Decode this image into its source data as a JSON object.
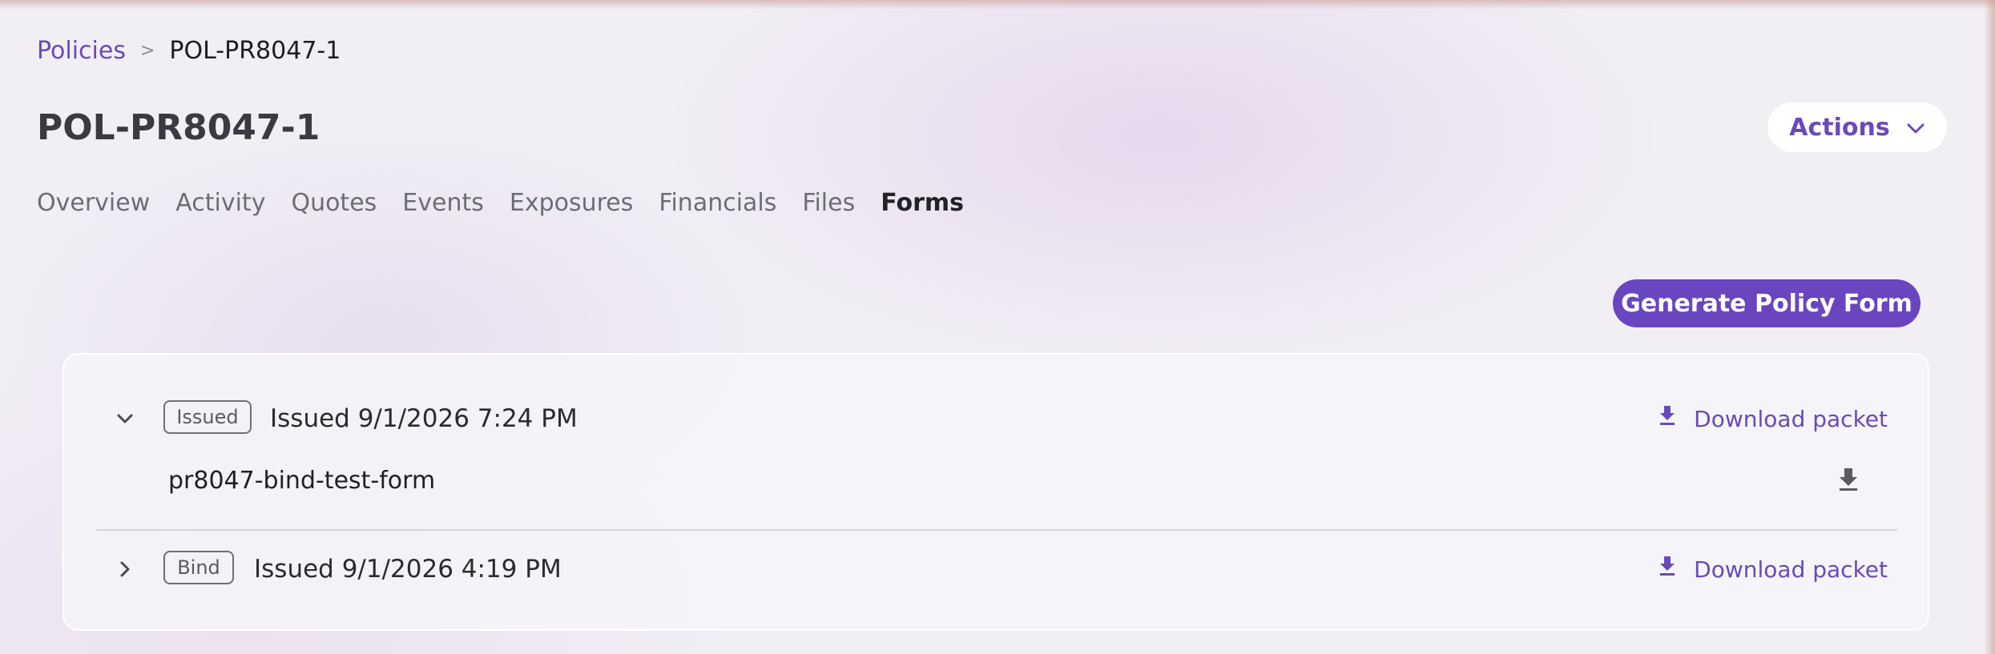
{
  "breadcrumb": {
    "parent": "Policies",
    "separator": ">",
    "current": "POL-PR8047-1"
  },
  "page": {
    "title": "POL-PR8047-1",
    "actions_label": "Actions"
  },
  "tabs": [
    {
      "label": "Overview",
      "active": false
    },
    {
      "label": "Activity",
      "active": false
    },
    {
      "label": "Quotes",
      "active": false
    },
    {
      "label": "Events",
      "active": false
    },
    {
      "label": "Exposures",
      "active": false
    },
    {
      "label": "Financials",
      "active": false
    },
    {
      "label": "Files",
      "active": false
    },
    {
      "label": "Forms",
      "active": true
    }
  ],
  "forms": {
    "generate_label": "Generate Policy Form",
    "groups": [
      {
        "badge": "Issued",
        "issued_text": "Issued 9/1/2026 7:24 PM",
        "download_label": "Download packet",
        "expanded": true,
        "files": [
          {
            "name": "pr8047-bind-test-form"
          }
        ]
      },
      {
        "badge": "Bind",
        "issued_text": "Issued 9/1/2026 4:19 PM",
        "download_label": "Download packet",
        "expanded": false
      }
    ]
  },
  "colors": {
    "accent": "#6a4ab8",
    "primary_button": "#6a45c0",
    "background": "#f1eef4",
    "text_dark": "#2a2a32",
    "text_muted": "#6c6c78"
  },
  "icons": {
    "breadcrumb_separator": "chevron-right-icon",
    "actions_chevron": "chevron-down-icon",
    "expanded_row": "chevron-down-icon",
    "collapsed_row": "chevron-right-icon",
    "download": "download-icon"
  }
}
